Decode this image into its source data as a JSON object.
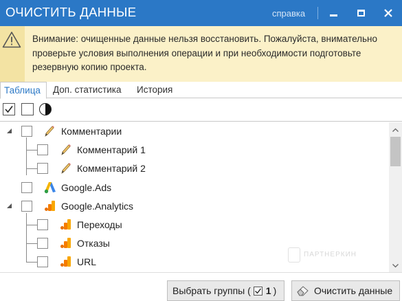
{
  "window": {
    "title": "ОЧИСТИТЬ ДАННЫЕ",
    "help_label": "справка"
  },
  "warning": {
    "text": "Внимание: очищенные данные нельзя восстановить. Пожалуйста, внимательно проверьте условия выполнения операции и при необходимости подготовьте резервную копию проекта."
  },
  "tabs": [
    {
      "label": "Таблица",
      "active": true
    },
    {
      "label": "Доп. статистика",
      "active": false
    },
    {
      "label": "История",
      "active": false
    }
  ],
  "tree": [
    {
      "label": "Комментарии",
      "icon": "pencil-icon",
      "expanded": true,
      "checked": false
    },
    {
      "label": "Комментарий 1",
      "icon": "pencil-icon",
      "checked": false
    },
    {
      "label": "Комментарий 2",
      "icon": "pencil-icon",
      "checked": false
    },
    {
      "label": "Google.Ads",
      "icon": "google-ads-icon",
      "checked": false
    },
    {
      "label": "Google.Analytics",
      "icon": "google-analytics-icon",
      "expanded": true,
      "checked": false
    },
    {
      "label": "Переходы",
      "icon": "google-analytics-icon",
      "checked": false
    },
    {
      "label": "Отказы",
      "icon": "google-analytics-icon",
      "checked": false
    },
    {
      "label": "URL",
      "icon": "google-analytics-icon",
      "checked": false
    }
  ],
  "footer": {
    "select_groups_label": "Выбрать группы (",
    "select_groups_count": "1",
    "select_groups_close": ")",
    "clear_label": "Очистить данные"
  },
  "watermark": "ПАРТНЕРКИН",
  "colors": {
    "titlebar": "#2b78c6",
    "warning_bg": "#fbf1c8",
    "accent": "#2b78c6"
  }
}
